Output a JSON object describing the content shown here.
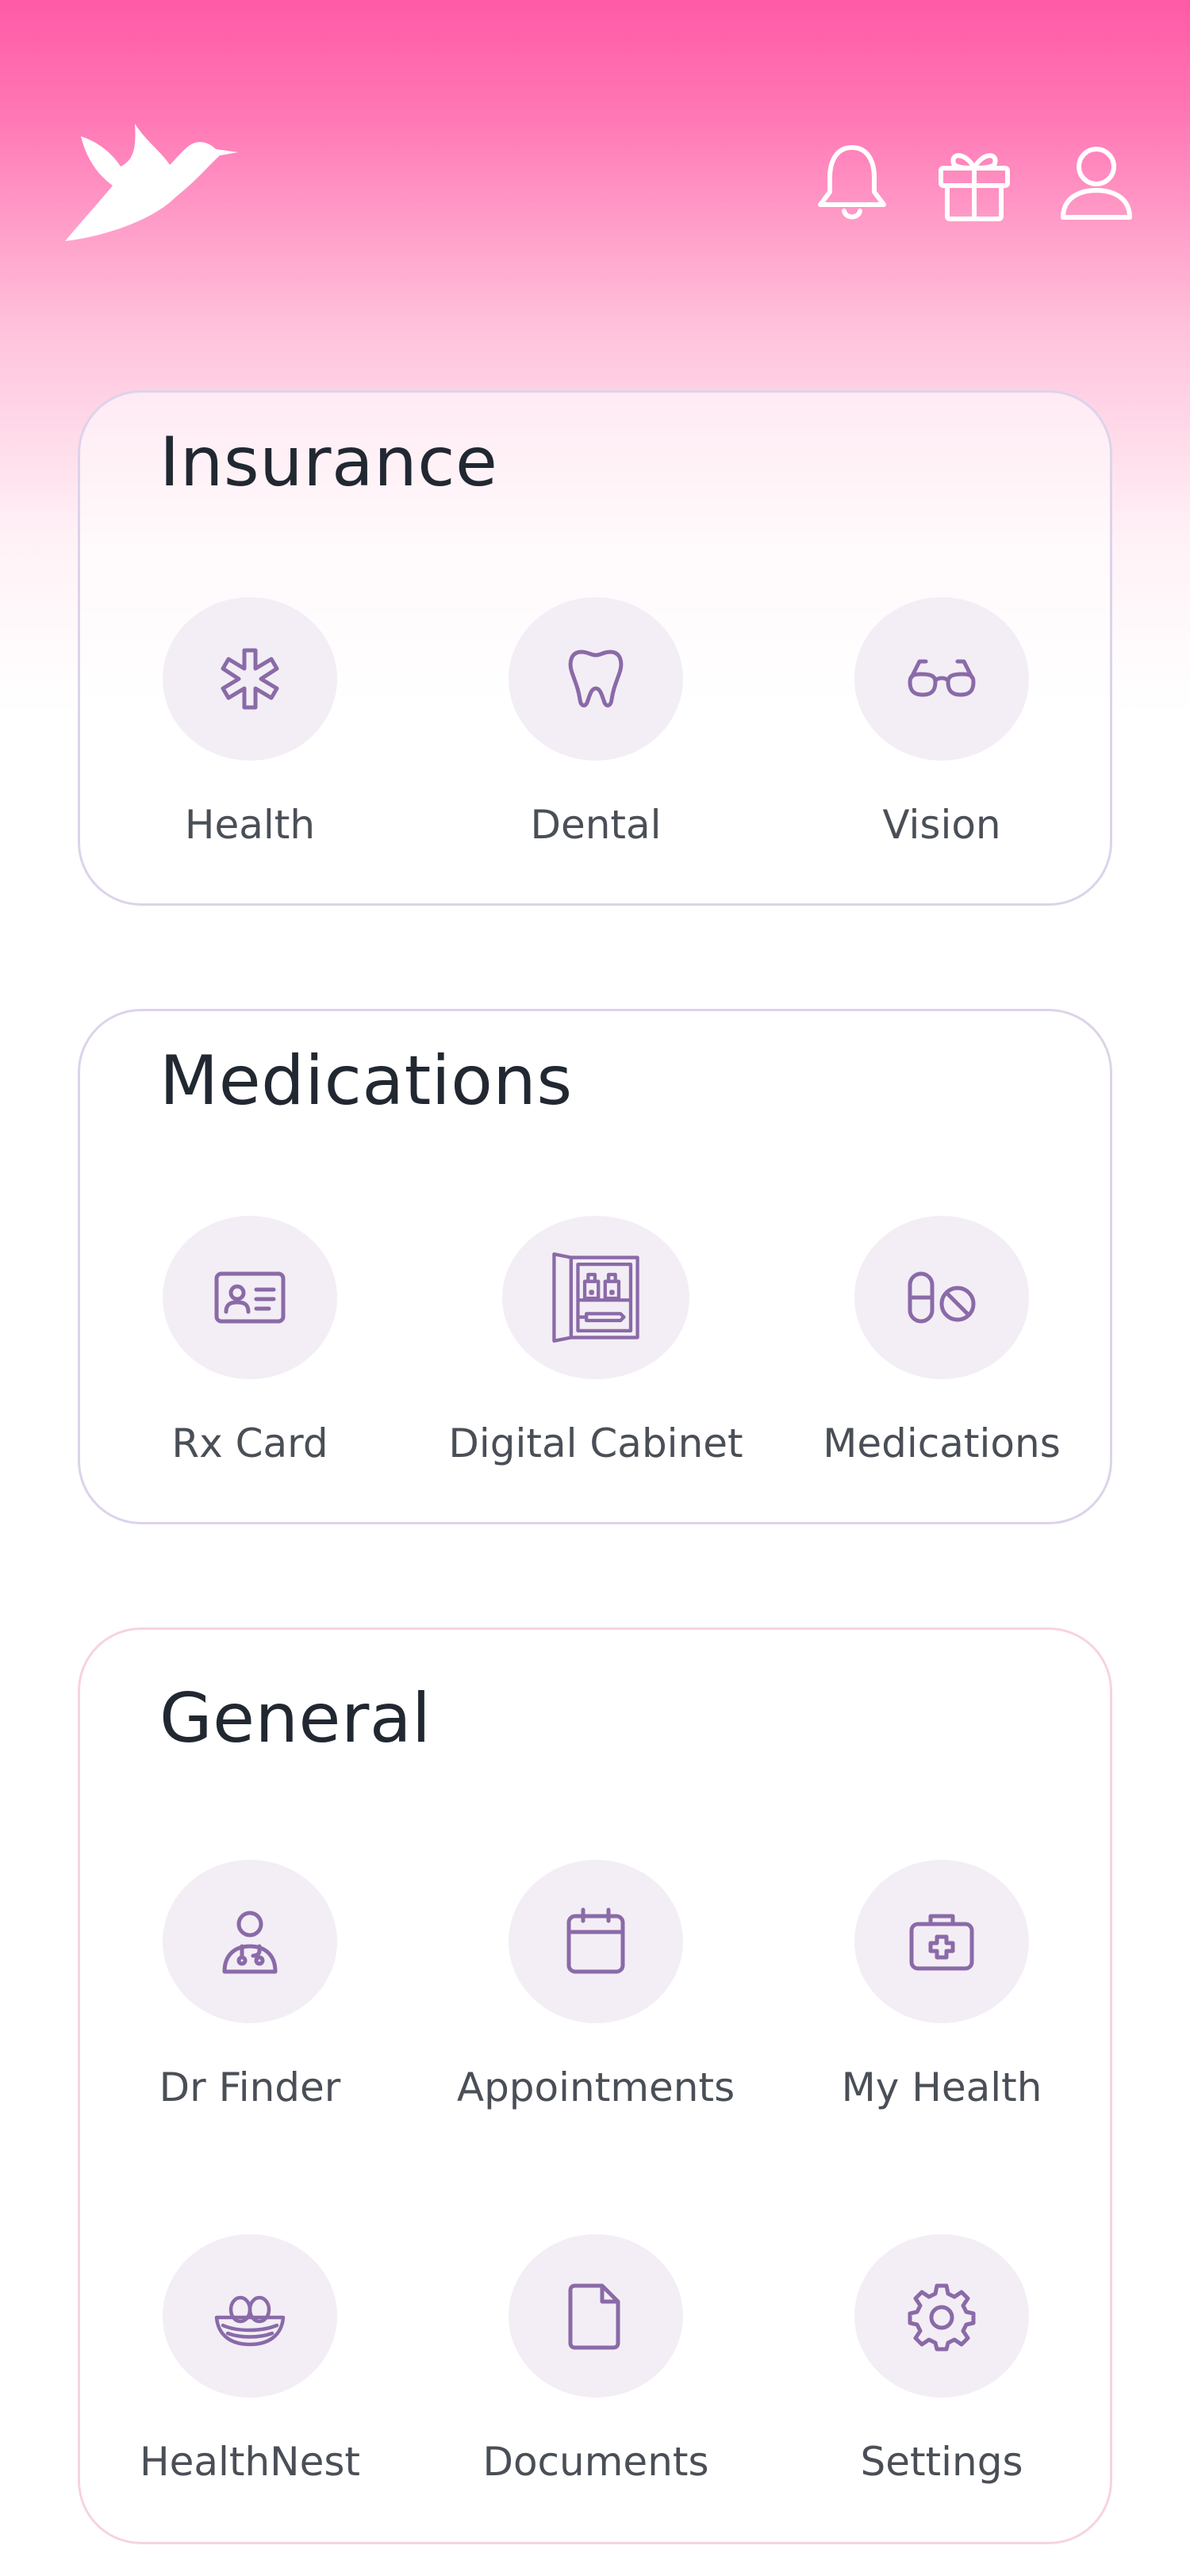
{
  "header": {
    "logo": "hummingbird-logo",
    "icons": [
      "bell-icon",
      "gift-icon",
      "user-icon"
    ]
  },
  "colors": {
    "gradient_top": "#ff5aa6",
    "icon_purple": "#8a6aa8",
    "circle_bg": "#f3eef5",
    "card_border": "#ddd3ea",
    "general_border": "#f7d3e0"
  },
  "sections": {
    "insurance": {
      "title": "Insurance",
      "items": [
        {
          "label": "Health",
          "icon": "medical-star-icon"
        },
        {
          "label": "Dental",
          "icon": "tooth-icon"
        },
        {
          "label": "Vision",
          "icon": "glasses-icon"
        }
      ]
    },
    "medications": {
      "title": "Medications",
      "items": [
        {
          "label": "Rx Card",
          "icon": "id-card-icon"
        },
        {
          "label": "Digital Cabinet",
          "icon": "medicine-cabinet-icon"
        },
        {
          "label": "Medications",
          "icon": "pill-icon"
        }
      ]
    },
    "general": {
      "title": "General",
      "items": [
        {
          "label": "Dr Finder",
          "icon": "doctor-icon"
        },
        {
          "label": "Appointments",
          "icon": "calendar-icon"
        },
        {
          "label": "My Health",
          "icon": "first-aid-kit-icon"
        },
        {
          "label": "HealthNest",
          "icon": "nest-icon"
        },
        {
          "label": "Documents",
          "icon": "document-icon"
        },
        {
          "label": "Settings",
          "icon": "gear-icon"
        }
      ]
    }
  }
}
